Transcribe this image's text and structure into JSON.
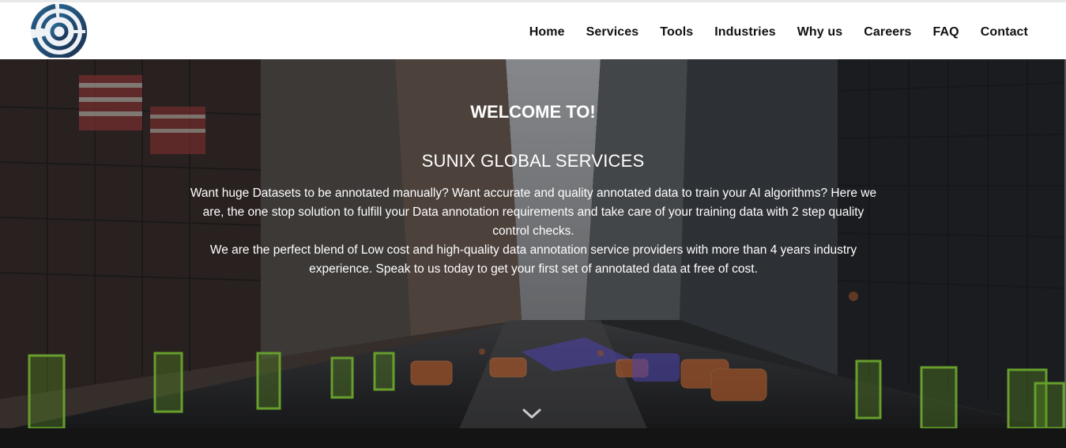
{
  "header": {
    "logo_icon": "concentric-circles-logo-icon",
    "nav": [
      {
        "label": "Home"
      },
      {
        "label": "Services"
      },
      {
        "label": "Tools"
      },
      {
        "label": "Industries"
      },
      {
        "label": "Why us"
      },
      {
        "label": "Careers"
      },
      {
        "label": "FAQ"
      },
      {
        "label": "Contact"
      }
    ]
  },
  "hero": {
    "welcome": "WELCOME TO!",
    "company": "SUNIX GLOBAL SERVICES",
    "paragraph1": "Want huge Datasets to be annotated manually? Want accurate and quality annotated data to train your AI algorithms? Here we are, the one stop solution to fulfill your Data annotation requirements and take care of your training data with 2 step quality control checks.",
    "paragraph2": "We are the perfect blend of Low cost and high-quality data annotation service providers with more than 4 years industry experience. Speak to us today to get your first set of annotated data at free of cost.",
    "scroll_icon": "chevron-down-icon",
    "colors": {
      "annotation_person": "#7dc832",
      "annotation_car": "#e2743a",
      "annotation_road": "#6a5cf0"
    }
  }
}
